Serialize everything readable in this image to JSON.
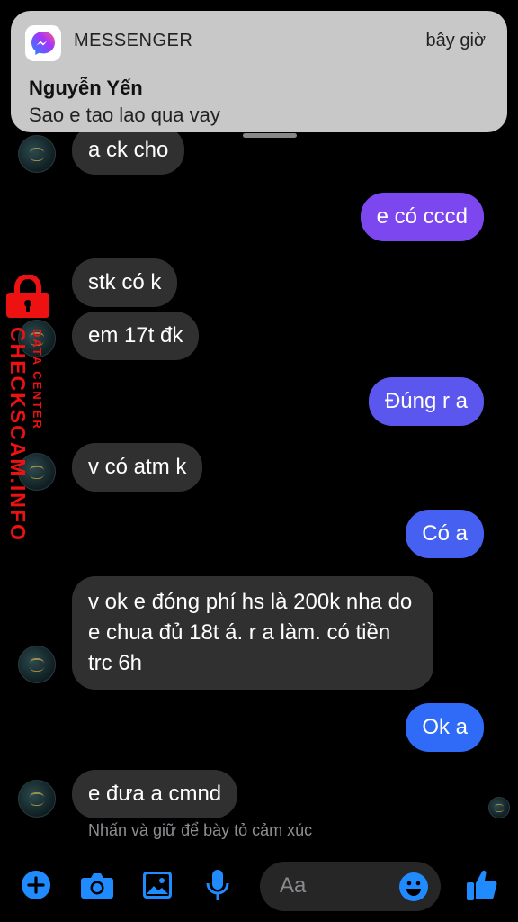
{
  "notification": {
    "app_name": "MESSENGER",
    "time": "bây giờ",
    "sender": "Nguyễn Yến",
    "message": "Sao e tao lao qua vay"
  },
  "messages": [
    {
      "from": "them",
      "text": "a ck cho"
    },
    {
      "from": "me",
      "text": "e có cccd"
    },
    {
      "from": "them",
      "text": "stk có k"
    },
    {
      "from": "them",
      "text": "em 17t đk"
    },
    {
      "from": "me",
      "text": "Đúng r a"
    },
    {
      "from": "them",
      "text": "v có atm k"
    },
    {
      "from": "me",
      "text": "Có a"
    },
    {
      "from": "them",
      "text": "v ok e đóng phí hs là 200k nha do e chua đủ 18t á. r a làm. có tiền trc 6h"
    },
    {
      "from": "me",
      "text": "Ok a"
    },
    {
      "from": "them",
      "text": "e đưa a cmnd"
    }
  ],
  "reaction_hint": "Nhấn và giữ để bày tỏ cảm xúc",
  "composer": {
    "placeholder": "Aa"
  },
  "watermark": {
    "main": "CHECKSCAM.INFO",
    "sub": "DATA CENTER"
  },
  "icons": [
    "plus-icon",
    "camera-icon",
    "image-icon",
    "mic-icon",
    "emoji-icon",
    "thumbs-up-icon",
    "messenger-icon",
    "lock-icon"
  ],
  "colors": {
    "background": "#000000",
    "incoming_bubble": "#303030",
    "outgoing_gradient_top": "#7b4bf2",
    "outgoing_gradient_bottom": "#2f6cf5",
    "accent": "#1f8bff",
    "watermark": "#e11111"
  }
}
